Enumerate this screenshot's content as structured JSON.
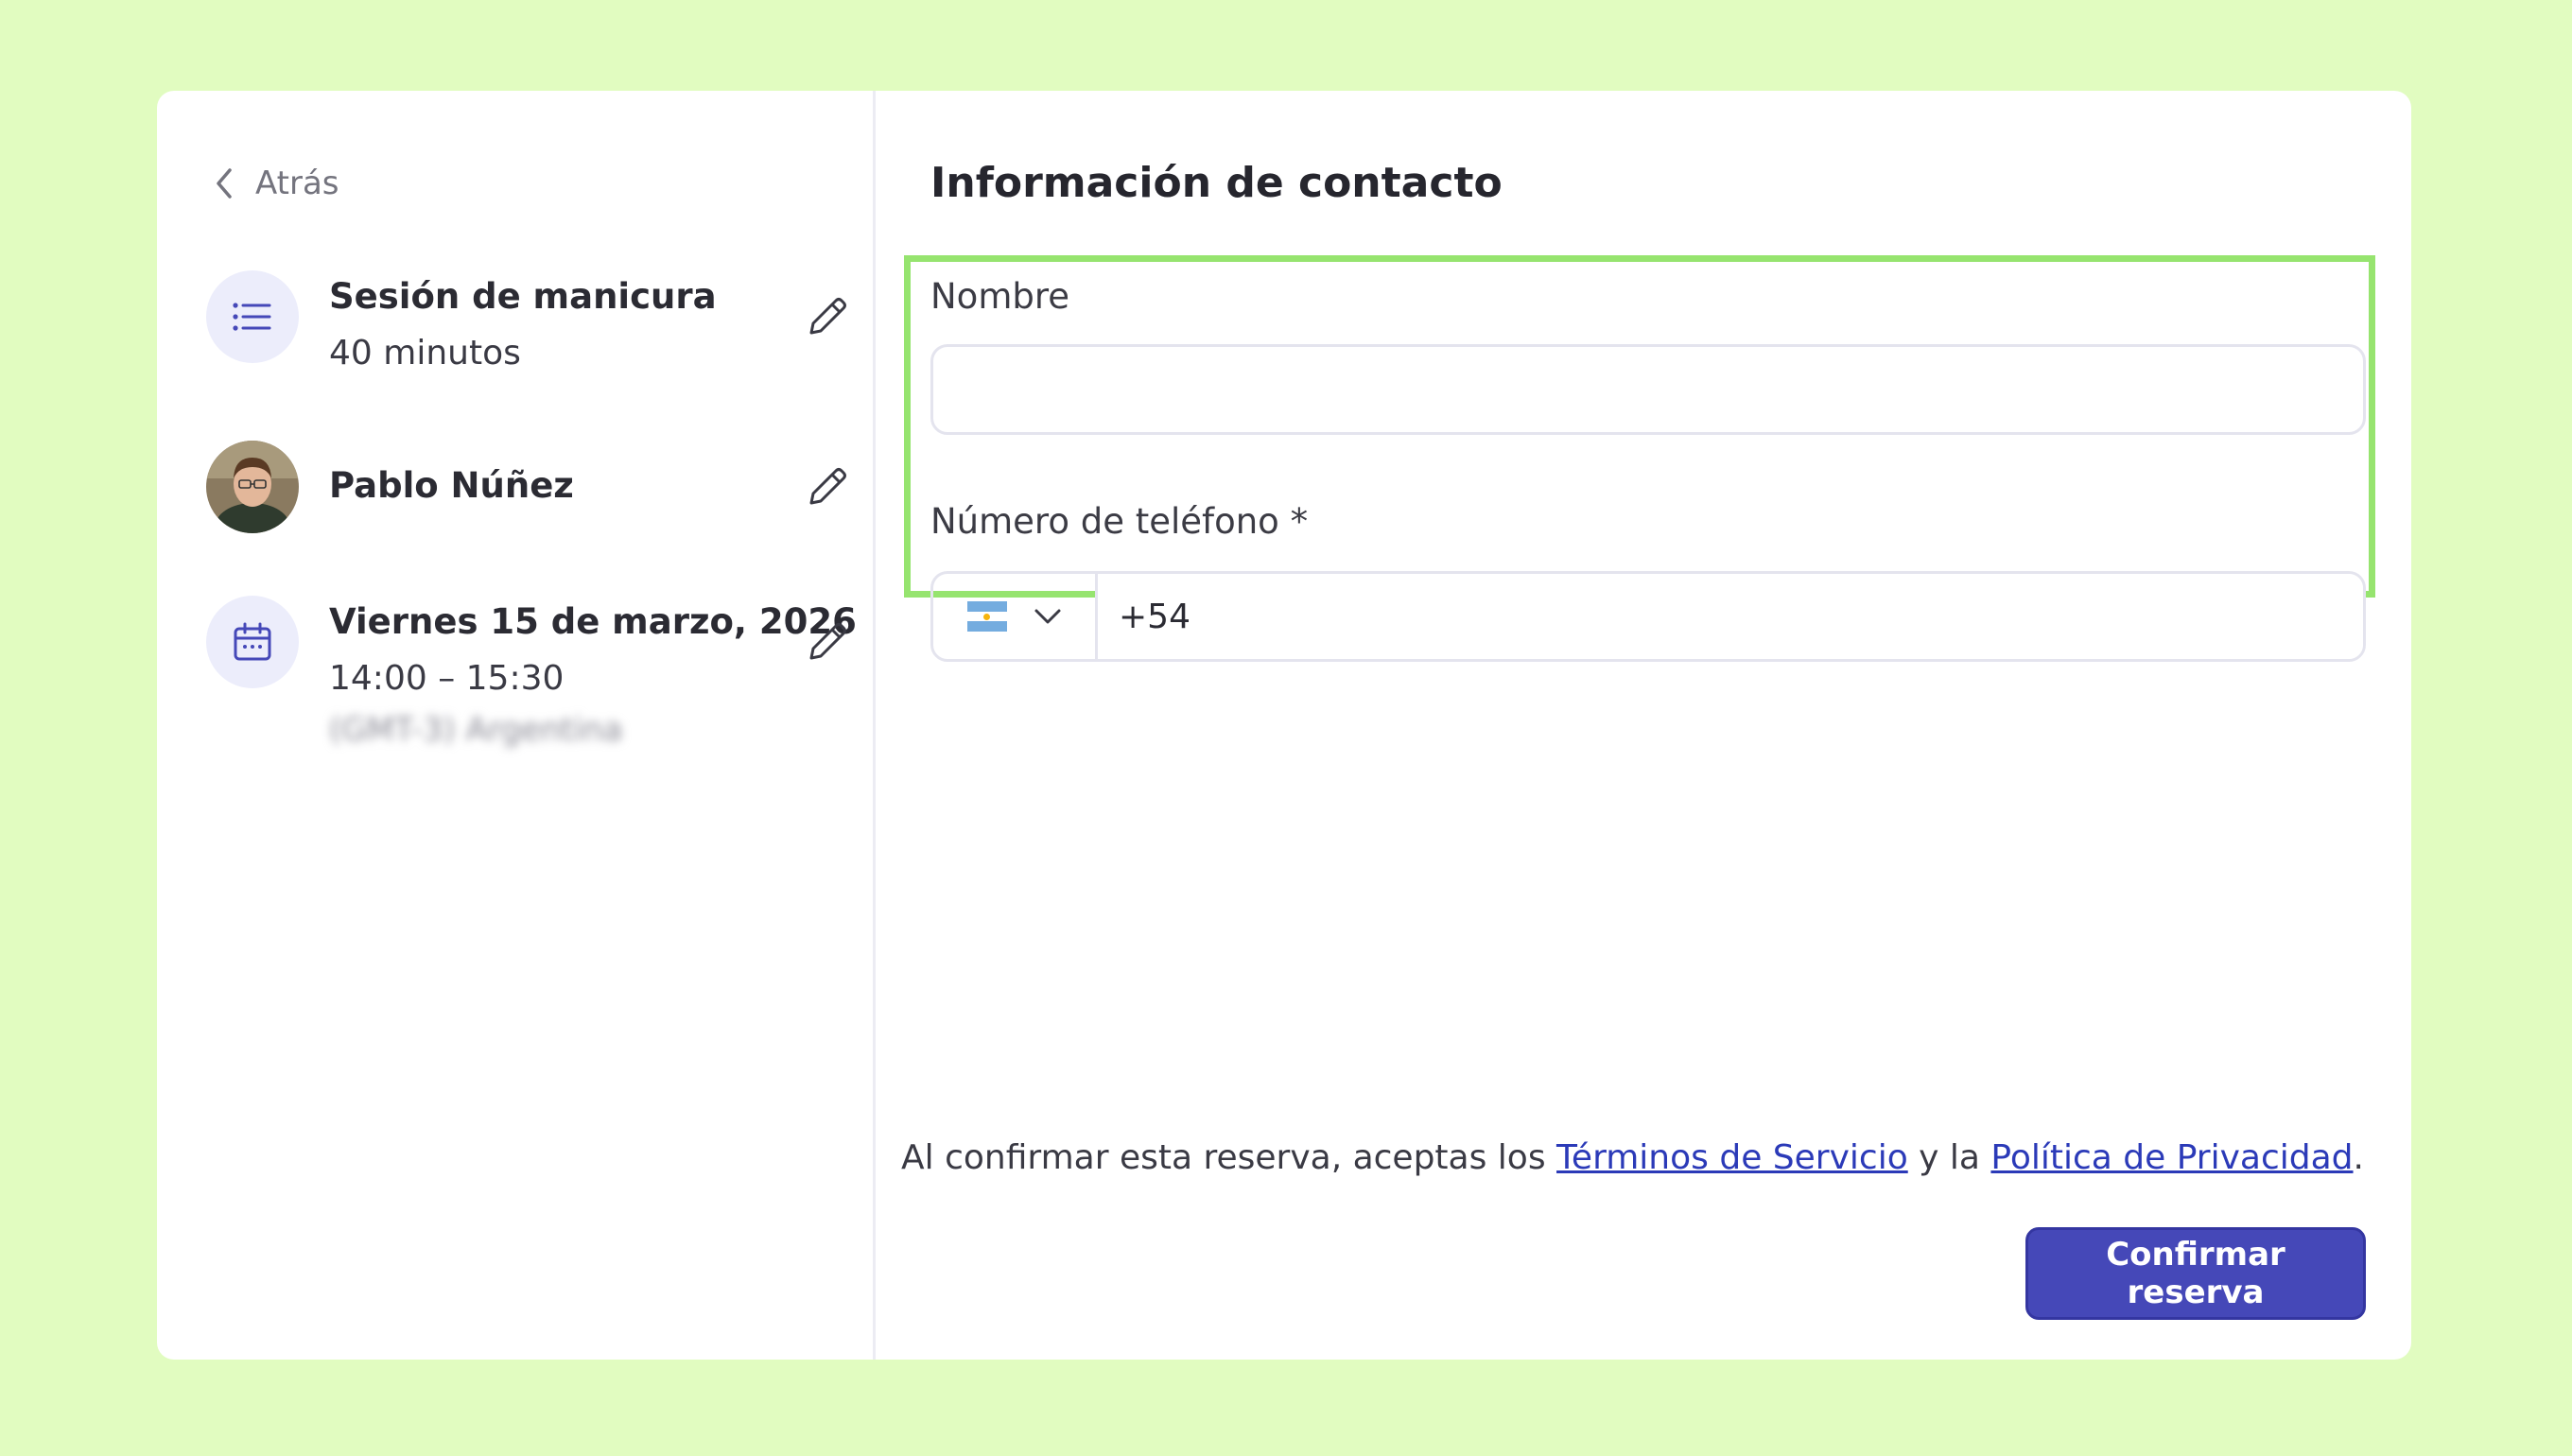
{
  "navigation": {
    "back_label": "Atrás"
  },
  "summary": {
    "service": {
      "title": "Sesión de manicura",
      "duration": "40 minutos",
      "icon": "list-icon"
    },
    "staff": {
      "name": "Pablo Núñez",
      "icon": "avatar"
    },
    "schedule": {
      "date": "Viernes 15 de marzo, 2026",
      "time": "14:00 – 15:30",
      "timezone": "(GMT-3) Argentina",
      "icon": "calendar-icon"
    },
    "edit_icon": "pencil-icon"
  },
  "contact": {
    "title": "Información de contacto",
    "name_label": "Nombre",
    "name_value": "",
    "phone_label": "Número de teléfono *",
    "phone_country": "Argentina",
    "phone_value": "+54"
  },
  "footer": {
    "legal_prefix": "Al confirmar esta reserva, aceptas los ",
    "terms_link": "Términos de Servicio",
    "legal_middle": " y la ",
    "privacy_link": "Política de Privacidad",
    "legal_suffix": ".",
    "confirm_label": "Confirmar reserva"
  },
  "colors": {
    "page_background": "#e1fcc0",
    "accent": "#4548b8",
    "highlight": "#96e46f",
    "link": "#2b3ab8"
  }
}
